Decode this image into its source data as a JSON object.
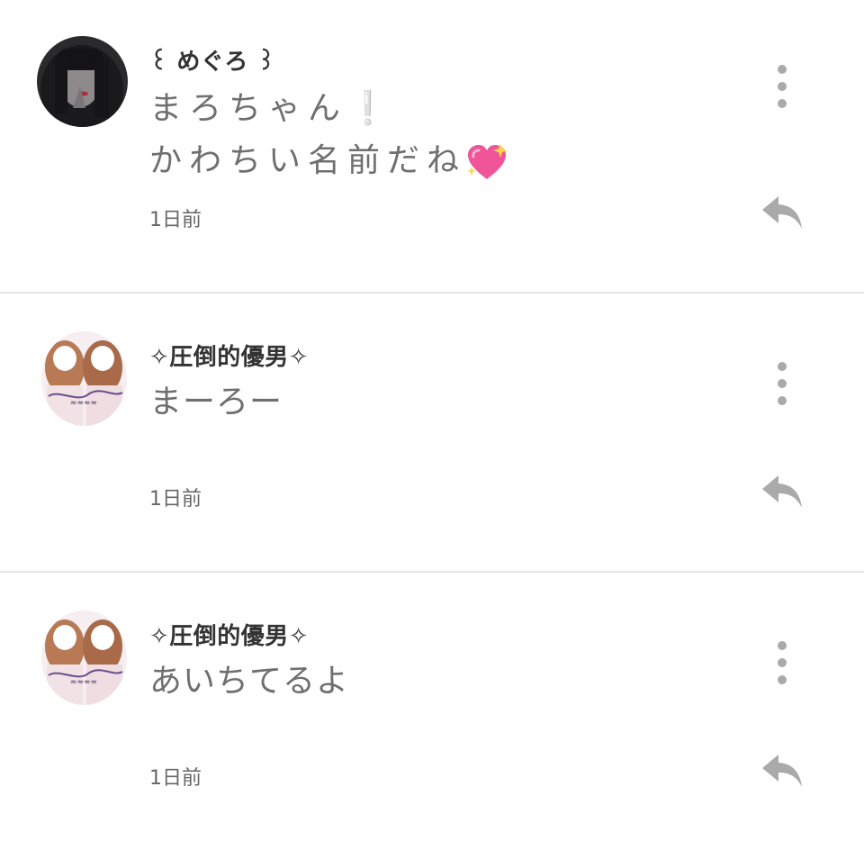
{
  "comments": [
    {
      "author": "꒰ めぐろ ꒱",
      "lines": [
        "まろちゃん❕",
        "かわちい名前だね"
      ],
      "time": "1日前",
      "avatar_icon": "dark-haired-girl-avatar",
      "emoji_icon": "sparkling-heart-icon"
    },
    {
      "author": "✧圧倒的優男✧",
      "lines": [
        "まーろー"
      ],
      "time": "1日前",
      "avatar_icon": "two-girls-purikura-avatar"
    },
    {
      "author": "✧圧倒的優男✧",
      "lines": [
        "あいちてるよ"
      ],
      "time": "1日前",
      "avatar_icon": "two-girls-purikura-avatar"
    }
  ],
  "colors": {
    "author": "#333333",
    "body": "#6f6f6f",
    "icon": "#aaaaaa",
    "divider": "#e6e6e6",
    "heart": "#f0559a"
  }
}
